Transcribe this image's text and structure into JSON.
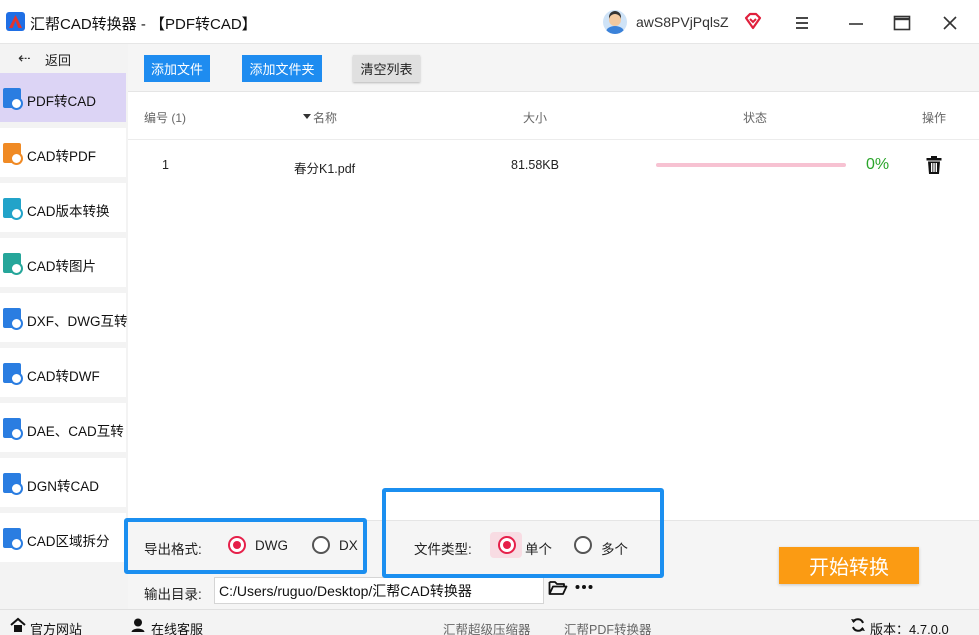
{
  "window": {
    "title": "汇帮CAD转换器 - 【PDF转CAD】",
    "username": "awS8PVjPqlsZ",
    "icons": [
      "app-logo-icon",
      "user-avatar",
      "vip-diamond-icon",
      "hamburger-menu-icon",
      "minimize-icon",
      "maximize-icon",
      "close-icon"
    ]
  },
  "sidebar": {
    "back_label": "返回",
    "items": [
      {
        "label": "PDF转CAD",
        "active": true,
        "icon": "pdf-to-cad-icon"
      },
      {
        "label": "CAD转PDF",
        "active": false,
        "icon": "cad-to-pdf-icon"
      },
      {
        "label": "CAD版本转换",
        "active": false,
        "icon": "cad-version-icon"
      },
      {
        "label": "CAD转图片",
        "active": false,
        "icon": "cad-to-image-icon"
      },
      {
        "label": "DXF、DWG互转",
        "active": false,
        "icon": "dxf-dwg-icon"
      },
      {
        "label": "CAD转DWF",
        "active": false,
        "icon": "cad-to-dwf-icon"
      },
      {
        "label": "DAE、CAD互转",
        "active": false,
        "icon": "dae-cad-icon"
      },
      {
        "label": "DGN转CAD",
        "active": false,
        "icon": "dgn-to-cad-icon"
      },
      {
        "label": "CAD区域拆分",
        "active": false,
        "icon": "cad-split-icon"
      }
    ]
  },
  "toolbar": {
    "add_file": "添加文件",
    "add_folder": "添加文件夹",
    "clear_list": "清空列表"
  },
  "table": {
    "headers": {
      "index": "编号 (1)",
      "name": "名称",
      "size": "大小",
      "status": "状态",
      "action": "操作"
    },
    "rows": [
      {
        "index": "1",
        "name": "春分K1.pdf",
        "size": "81.58KB",
        "progress_percent": 0,
        "progress_text": "0%"
      }
    ]
  },
  "settings": {
    "export_format_label": "导出格式:",
    "export_formats": [
      "DWG",
      "DXF"
    ],
    "export_format_visible_second": "DX",
    "export_format_selected": "DWG",
    "file_type_label": "文件类型:",
    "file_types": [
      "单个",
      "多个"
    ],
    "file_type_selected": "单个",
    "output_dir_label": "输出目录:",
    "output_dir_value": "C:/Users/ruguo/Desktop/汇帮CAD转换器",
    "start_button": "开始转换"
  },
  "statusbar": {
    "website": "官方网站",
    "support": "在线客服",
    "link1": "汇帮超级压缩器",
    "link2": "汇帮PDF转换器",
    "version": "版本：4.7.0.0"
  },
  "colors": {
    "accent_blue": "#1e8cf0",
    "highlight_box": "#1b8ff0",
    "active_nav": "#dcd4f5",
    "radio_selected": "#e6204a",
    "progress": "#f7c2d2",
    "percent_text": "#2aa52a",
    "start_button": "#fb9b13"
  }
}
